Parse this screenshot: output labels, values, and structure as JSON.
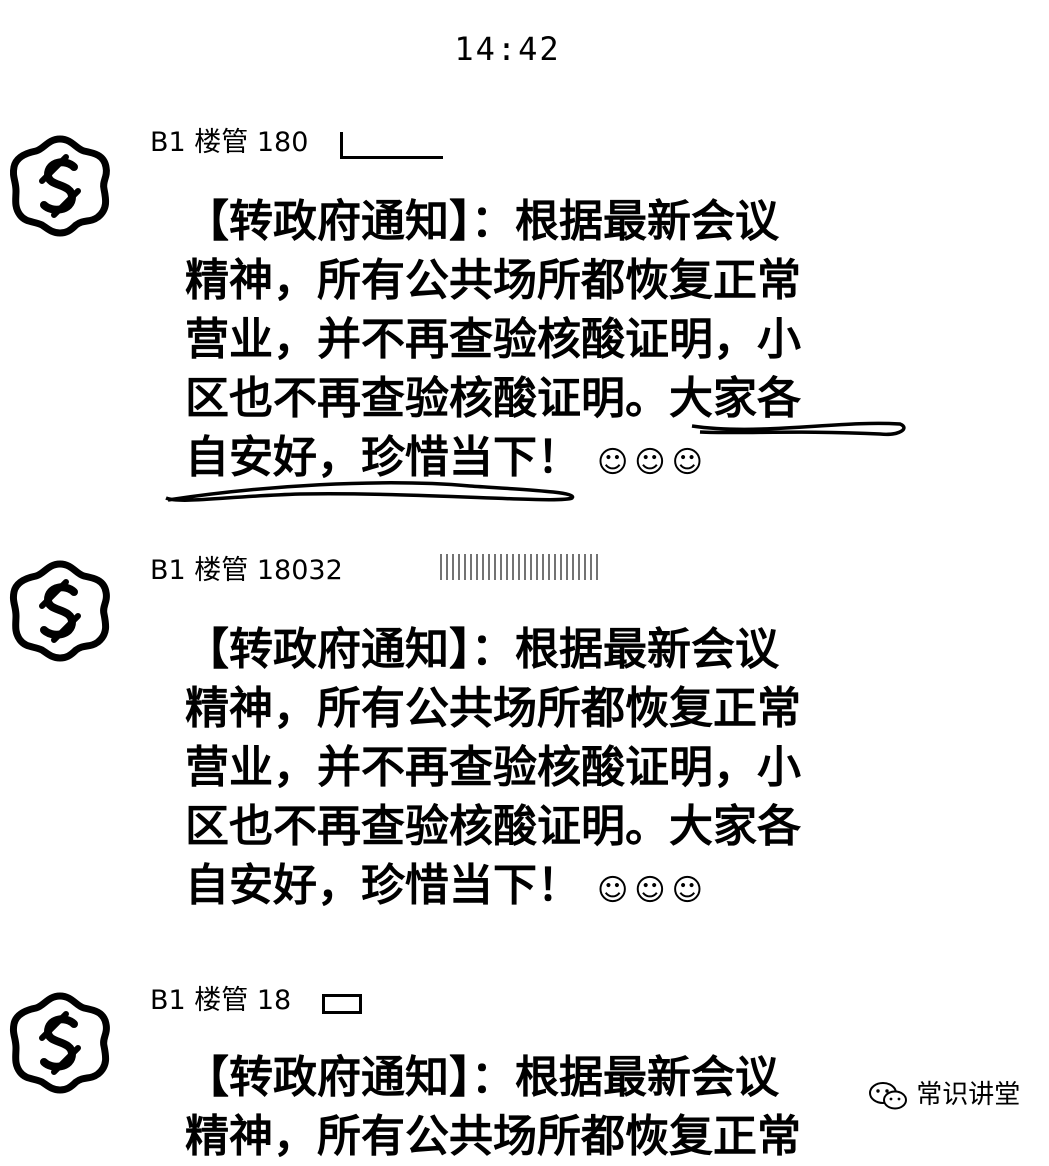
{
  "status_bar": {
    "time": "14:42"
  },
  "messages": [
    {
      "sender": "B1 楼管 180",
      "lines": [
        "【转政府通知】：根据最新会议",
        "精神，所有公共场所都恢复正常",
        "营业，并不再查验核酸证明，小",
        "区也不再查验核酸证明。大家各",
        "自安好，珍惜当下！"
      ],
      "emoji": [
        "☺",
        "☺",
        "☺"
      ]
    },
    {
      "sender": "B1 楼管 18032",
      "lines": [
        "【转政府通知】：根据最新会议",
        "精神，所有公共场所都恢复正常",
        "营业，并不再查验核酸证明，小",
        "区也不再查验核酸证明。大家各",
        "自安好，珍惜当下！"
      ],
      "emoji": [
        "☺",
        "☺",
        "☺"
      ]
    },
    {
      "sender": "B1 楼管 18",
      "lines": [
        "【转政府通知】：根据最新会议",
        "精神，所有公共场所都恢复正常"
      ],
      "emoji": []
    }
  ],
  "watermark": {
    "text": "常识讲堂",
    "icon": "wechat-icon"
  },
  "icons": {
    "avatar": "intertwined-s-logo-icon"
  },
  "colors": {
    "background": "#ffffff",
    "text": "#000000"
  }
}
